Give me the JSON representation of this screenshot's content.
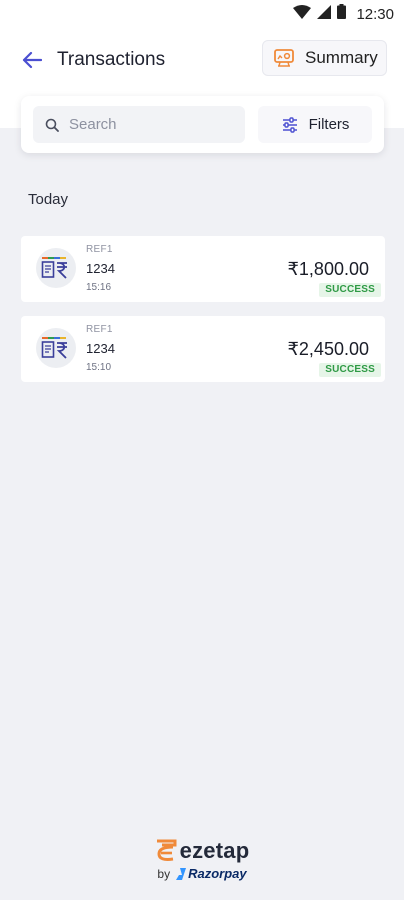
{
  "status_bar": {
    "time": "12:30",
    "icons": [
      "wifi-icon",
      "signal-icon",
      "battery-icon"
    ]
  },
  "header": {
    "title": "Transactions",
    "summary_label": "Summary"
  },
  "search": {
    "placeholder": "Search",
    "value": ""
  },
  "filters": {
    "label": "Filters"
  },
  "section": {
    "label": "Today"
  },
  "transactions": [
    {
      "ref_label": "REF1",
      "id": "1234",
      "time": "15:16",
      "amount": "₹1,800.00",
      "status": "SUCCESS"
    },
    {
      "ref_label": "REF1",
      "id": "1234",
      "time": "15:10",
      "amount": "₹2,450.00",
      "status": "SUCCESS"
    }
  ],
  "footer": {
    "brand": "ezetap",
    "by": "by",
    "partner": "Razorpay"
  },
  "colors": {
    "accent": "#4b4fd1",
    "summary_icon": "#f08a3a",
    "success_bg": "#e6f5e8",
    "success_text": "#2f9a45",
    "background": "#f0f1f5"
  }
}
